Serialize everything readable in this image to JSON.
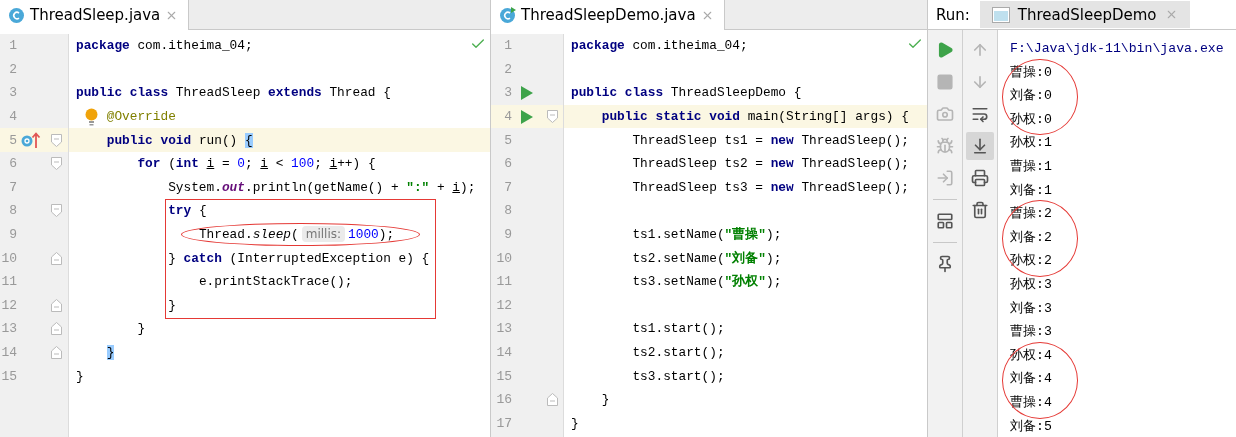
{
  "editors": [
    {
      "tab": {
        "title": "ThreadSleep.java",
        "selected": true
      },
      "lines": [
        {
          "number": "1",
          "tokens": [
            {
              "t": "package",
              "kind": "kw"
            },
            {
              "t": " com.itheima_04;",
              "kind": "plain"
            }
          ]
        },
        {
          "number": "2"
        },
        {
          "number": "3",
          "tokens": [
            {
              "t": "public class",
              "kind": "kw"
            },
            {
              "t": " ThreadSleep ",
              "kind": "plain"
            },
            {
              "t": "extends",
              "kind": "kw"
            },
            {
              "t": " Thread {",
              "kind": "plain"
            }
          ]
        },
        {
          "number": "4",
          "bulb": true,
          "tokens": [
            {
              "t": "    @Override",
              "kind": "annotation"
            }
          ]
        },
        {
          "number": "5",
          "highlighted": true,
          "override_mark": true,
          "fold_start": true,
          "tokens": [
            {
              "t": "    public void",
              "kind": "kw"
            },
            {
              "t": " run() ",
              "kind": "plain"
            },
            {
              "t": "{",
              "kind": "brace"
            }
          ]
        },
        {
          "number": "6",
          "fold_start": true,
          "tokens": [
            {
              "t": "        for",
              "kind": "kw"
            },
            {
              "t": " (",
              "kind": "plain"
            },
            {
              "t": "int ",
              "kind": "kw"
            },
            {
              "t": "i",
              "kind": "var"
            },
            {
              "t": " = ",
              "kind": "plain"
            },
            {
              "t": "0",
              "kind": "num"
            },
            {
              "t": "; ",
              "kind": "plain"
            },
            {
              "t": "i",
              "kind": "var"
            },
            {
              "t": " < ",
              "kind": "plain"
            },
            {
              "t": "100",
              "kind": "num"
            },
            {
              "t": "; ",
              "kind": "plain"
            },
            {
              "t": "i",
              "kind": "var"
            },
            {
              "t": "++) {",
              "kind": "plain"
            }
          ]
        },
        {
          "number": "7",
          "tokens": [
            {
              "t": "            System.",
              "kind": "plain"
            },
            {
              "t": "out",
              "kind": "field"
            },
            {
              "t": ".println(getName() + ",
              "kind": "plain"
            },
            {
              "t": "\":\"",
              "kind": "str"
            },
            {
              "t": " + ",
              "kind": "plain"
            },
            {
              "t": "i",
              "kind": "var"
            },
            {
              "t": ");",
              "kind": "plain"
            }
          ]
        },
        {
          "number": "8",
          "boxed": true,
          "fold_start": true,
          "tokens": [
            {
              "t": "            try",
              "kind": "kw"
            },
            {
              "t": " {",
              "kind": "plain"
            }
          ]
        },
        {
          "number": "9",
          "boxed": true,
          "circled": true,
          "tokens": [
            {
              "t": "                Thread.",
              "kind": "plain"
            },
            {
              "t": "sleep",
              "kind": "method"
            },
            {
              "t": "(",
              "kind": "plain"
            },
            {
              "t": "millis:",
              "kind": "hint"
            },
            {
              "t": "1000",
              "kind": "num"
            },
            {
              "t": ");",
              "kind": "plain"
            }
          ]
        },
        {
          "number": "10",
          "boxed": true,
          "fold_end": true,
          "tokens": [
            {
              "t": "            } ",
              "kind": "plain"
            },
            {
              "t": "catch",
              "kind": "kw"
            },
            {
              "t": " (InterruptedException e) {",
              "kind": "plain"
            }
          ]
        },
        {
          "number": "11",
          "boxed": true,
          "tokens": [
            {
              "t": "                e.printStackTrace();",
              "kind": "plain"
            }
          ]
        },
        {
          "number": "12",
          "boxed": true,
          "fold_end": true,
          "tokens": [
            {
              "t": "            }",
              "kind": "plain"
            }
          ]
        },
        {
          "number": "13",
          "fold_end": true,
          "tokens": [
            {
              "t": "        }",
              "kind": "plain"
            }
          ]
        },
        {
          "number": "14",
          "fold_end": true,
          "tokens": [
            {
              "t": "    }",
              "kind": "brace"
            }
          ]
        },
        {
          "number": "15",
          "tokens": [
            {
              "t": "}",
              "kind": "plain"
            }
          ]
        }
      ]
    },
    {
      "tab": {
        "title": "ThreadSleepDemo.java",
        "selected": true
      },
      "lines": [
        {
          "number": "1",
          "tokens": [
            {
              "t": "package",
              "kind": "kw"
            },
            {
              "t": " com.itheima_04;",
              "kind": "plain"
            }
          ]
        },
        {
          "number": "2"
        },
        {
          "number": "3",
          "run": true,
          "tokens": [
            {
              "t": "public class",
              "kind": "kw"
            },
            {
              "t": " ThreadSleepDemo {",
              "kind": "plain"
            }
          ]
        },
        {
          "number": "4",
          "run": true,
          "highlighted": true,
          "fold_start": true,
          "tokens": [
            {
              "t": "    public static void",
              "kind": "kw"
            },
            {
              "t": " main(String[] args) {",
              "kind": "plain"
            }
          ]
        },
        {
          "number": "5",
          "tokens": [
            {
              "t": "        ThreadSleep ts1 = ",
              "kind": "plain"
            },
            {
              "t": "new",
              "kind": "kw"
            },
            {
              "t": " ThreadSleep();",
              "kind": "plain"
            }
          ]
        },
        {
          "number": "6",
          "tokens": [
            {
              "t": "        ThreadSleep ts2 = ",
              "kind": "plain"
            },
            {
              "t": "new",
              "kind": "kw"
            },
            {
              "t": " ThreadSleep();",
              "kind": "plain"
            }
          ]
        },
        {
          "number": "7",
          "tokens": [
            {
              "t": "        ThreadSleep ts3 = ",
              "kind": "plain"
            },
            {
              "t": "new",
              "kind": "kw"
            },
            {
              "t": " ThreadSleep();",
              "kind": "plain"
            }
          ]
        },
        {
          "number": "8"
        },
        {
          "number": "9",
          "tokens": [
            {
              "t": "        ts1.setName(",
              "kind": "plain"
            },
            {
              "t": "\"曹操\"",
              "kind": "str"
            },
            {
              "t": ");",
              "kind": "plain"
            }
          ]
        },
        {
          "number": "10",
          "tokens": [
            {
              "t": "        ts2.setName(",
              "kind": "plain"
            },
            {
              "t": "\"刘备\"",
              "kind": "str"
            },
            {
              "t": ");",
              "kind": "plain"
            }
          ]
        },
        {
          "number": "11",
          "tokens": [
            {
              "t": "        ts3.setName(",
              "kind": "plain"
            },
            {
              "t": "\"孙权\"",
              "kind": "str"
            },
            {
              "t": ");",
              "kind": "plain"
            }
          ]
        },
        {
          "number": "12"
        },
        {
          "number": "13",
          "tokens": [
            {
              "t": "        ts1.start();",
              "kind": "plain"
            }
          ]
        },
        {
          "number": "14",
          "tokens": [
            {
              "t": "        ts2.start();",
              "kind": "plain"
            }
          ]
        },
        {
          "number": "15",
          "tokens": [
            {
              "t": "        ts3.start();",
              "kind": "plain"
            }
          ]
        },
        {
          "number": "16",
          "fold_end": true,
          "tokens": [
            {
              "t": "    }",
              "kind": "plain"
            }
          ]
        },
        {
          "number": "17",
          "tokens": [
            {
              "t": "}",
              "kind": "plain"
            }
          ]
        }
      ]
    }
  ],
  "run": {
    "label": "Run:",
    "tab": {
      "title": "ThreadSleepDemo",
      "selected": true
    },
    "tools": [
      [
        {
          "kind": "run",
          "disabled": false
        },
        {
          "kind": "stop",
          "disabled": true
        },
        {
          "kind": "camera",
          "disabled": true
        },
        {
          "kind": "debug",
          "disabled": true
        },
        {
          "kind": "exit",
          "disabled": true
        },
        {
          "kind": "divider"
        },
        {
          "kind": "layout",
          "disabled": false
        },
        {
          "kind": "divider"
        },
        {
          "kind": "pin",
          "disabled": false
        }
      ],
      [
        {
          "kind": "up",
          "disabled": true
        },
        {
          "kind": "down",
          "disabled": true
        },
        {
          "kind": "wrap",
          "disabled": false,
          "selected": false
        },
        {
          "kind": "scroll-end",
          "disabled": false,
          "selected": true
        },
        {
          "kind": "print",
          "disabled": false
        },
        {
          "kind": "trash",
          "disabled": false
        }
      ]
    ],
    "output": [
      {
        "text": "F:\\Java\\jdk-11\\bin\\java.exe",
        "kind": "command",
        "circled": false
      },
      {
        "text": "曹操:0",
        "kind": "output",
        "circled": true
      },
      {
        "text": "刘备:0",
        "kind": "output",
        "circled": true
      },
      {
        "text": "孙权:0",
        "kind": "output",
        "circled": true
      },
      {
        "text": "孙权:1",
        "kind": "output",
        "circled": false
      },
      {
        "text": "曹操:1",
        "kind": "output",
        "circled": false
      },
      {
        "text": "刘备:1",
        "kind": "output",
        "circled": false
      },
      {
        "text": "曹操:2",
        "kind": "output",
        "circled": true
      },
      {
        "text": "刘备:2",
        "kind": "output",
        "circled": true
      },
      {
        "text": "孙权:2",
        "kind": "output",
        "circled": true
      },
      {
        "text": "孙权:3",
        "kind": "output",
        "circled": false
      },
      {
        "text": "刘备:3",
        "kind": "output",
        "circled": false
      },
      {
        "text": "曹操:3",
        "kind": "output",
        "circled": false
      },
      {
        "text": "孙权:4",
        "kind": "output",
        "circled": true
      },
      {
        "text": "刘备:4",
        "kind": "output",
        "circled": true
      },
      {
        "text": "曹操:4",
        "kind": "output",
        "circled": true
      },
      {
        "text": "刘备:5",
        "kind": "output",
        "circled": false
      }
    ]
  }
}
